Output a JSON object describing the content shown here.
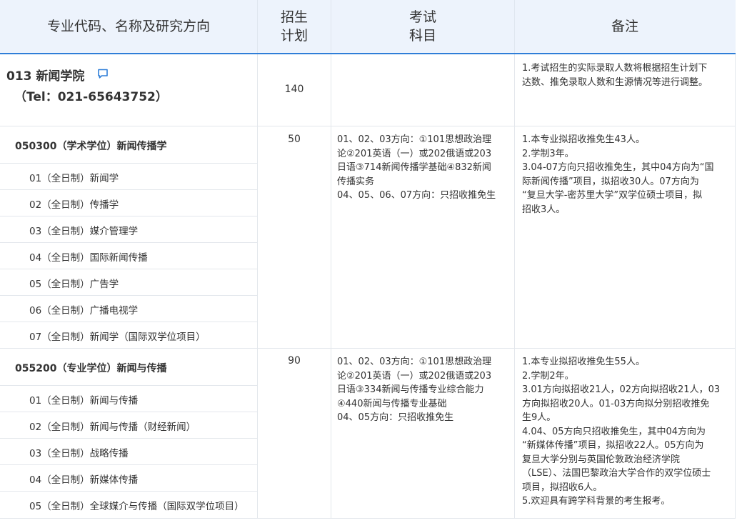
{
  "header": {
    "col1": "专业代码、名称及研究方向",
    "col2_line1": "招生",
    "col2_line2": "计划",
    "col3_line1": "考试",
    "col3_line2": "科目",
    "col4": "备注"
  },
  "department": {
    "name": "013 新闻学院",
    "tel": "（Tel：021-65643752）",
    "quota": "140",
    "notes": [
      "1.考试招生的实际录取人数将根据招生计划下",
      "达数、推免录取人数和生源情况等进行调整。"
    ]
  },
  "programs": [
    {
      "title": "050300（学术学位）新闻传播学",
      "quota": "50",
      "exam": [
        "01、02、03方向：①101思想政治理",
        "论②201英语（一）或202俄语或203",
        "日语③714新闻传播学基础④832新闻",
        "传播实务",
        "04、05、06、07方向：只招收推免生"
      ],
      "notes": [
        "1.本专业拟招收推免生43人。",
        "2.学制3年。",
        "3.04-07方向只招收推免生，其中04方向为“国",
        "际新闻传播”项目，拟招收30人。07方向为",
        "“复旦大学-密苏里大学”双学位硕士项目，拟",
        "招收3人。"
      ],
      "directions": [
        "01（全日制）新闻学",
        "02（全日制）传播学",
        "03（全日制）媒介管理学",
        "04（全日制）国际新闻传播",
        "05（全日制）广告学",
        "06（全日制）广播电视学",
        "07（全日制）新闻学（国际双学位项目）"
      ]
    },
    {
      "title": "055200（专业学位）新闻与传播",
      "quota": "90",
      "exam": [
        "01、02、03方向：①101思想政治理",
        "论②201英语（一）或202俄语或203",
        "日语③334新闻与传播专业综合能力",
        "④440新闻与传播专业基础",
        "04、05方向：只招收推免生"
      ],
      "notes": [
        "1.本专业拟招收推免生55人。",
        "2.学制2年。",
        "3.01方向拟招收21人，02方向拟招收21人，03",
        "方向拟招收20人。01-03方向拟分别招收推免",
        "生9人。",
        "4.04、05方向只招收推免生，其中04方向为",
        "“新媒体传播”项目，拟招收22人。05方向为",
        "复旦大学分别与英国伦敦政治经济学院",
        "（LSE）、法国巴黎政治大学合作的双学位硕士",
        "项目，拟招收6人。",
        "5.欢迎具有跨学科背景的考生报考。"
      ],
      "directions": [
        "01（全日制）新闻与传播",
        "02（全日制）新闻与传播（财经新闻）",
        "03（全日制）战略传播",
        "04（全日制）新媒体传播",
        "05（全日制）全球媒介与传播（国际双学位项目）"
      ]
    }
  ],
  "icons": {
    "comment": "comment-icon"
  },
  "colors": {
    "header_bg": "#edf3fc",
    "accent": "#2f7ed8",
    "grid": "#e3e7ec"
  }
}
